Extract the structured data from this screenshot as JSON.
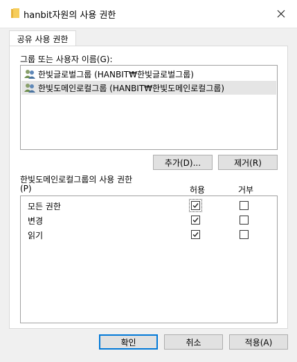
{
  "window": {
    "title": "hanbit자원의 사용 권한",
    "close_icon": "close-icon",
    "folder_icon": "folder-icon"
  },
  "tabs": [
    {
      "label": "공유 사용 권한",
      "active": true
    }
  ],
  "groups": {
    "label": "그룹 또는 사용자 이름(G):",
    "items": [
      {
        "icon": "user-group-icon",
        "name": "한빛글로벌그룹 (HANBIT₩한빛글로벌그룹)",
        "selected": false
      },
      {
        "icon": "user-group-icon",
        "name": "한빛도메인로컬그룹 (HANBIT₩한빛도메인로컬그룹)",
        "selected": true
      }
    ],
    "add_button": "추가(D)...",
    "remove_button": "제거(R)"
  },
  "permissions": {
    "label_line1": "한빛도메인로컬그룹의 사용 권한",
    "label_line2": "(P)",
    "allow_header": "허용",
    "deny_header": "거부",
    "rows": [
      {
        "name": "모든 권한",
        "allow": true,
        "deny": false
      },
      {
        "name": "변경",
        "allow": true,
        "deny": false
      },
      {
        "name": "읽기",
        "allow": true,
        "deny": false
      }
    ]
  },
  "footer": {
    "ok": "확인",
    "cancel": "취소",
    "apply": "적용(A)"
  }
}
